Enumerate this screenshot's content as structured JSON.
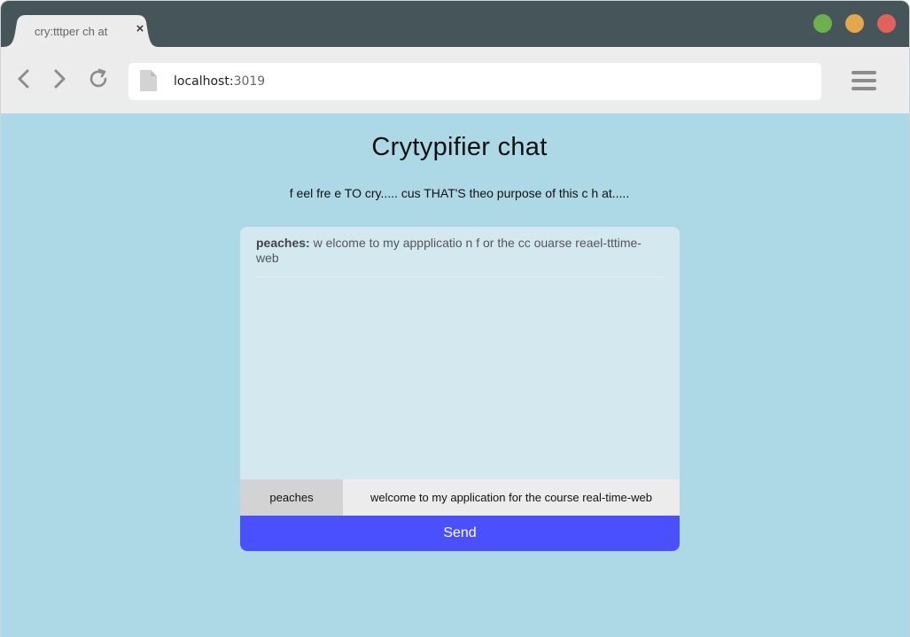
{
  "browser": {
    "tab": {
      "title": "cry:tttper ch at",
      "close_glyph": "×"
    },
    "window_controls": {
      "colors": {
        "green": "#6db14a",
        "yellow": "#e2a84b",
        "red": "#e0625a"
      }
    },
    "url": {
      "host": "localhost:",
      "port": "3019"
    },
    "icons": [
      "back-arrow-icon",
      "forward-arrow-icon",
      "reload-icon",
      "page-icon",
      "hamburger-menu-icon"
    ]
  },
  "page": {
    "title": "Crytypifier chat",
    "subtitle": "f eel fre e TO cry..... cus THAT'S theo purpose of this c h at.....",
    "background": "#add8e6"
  },
  "chat": {
    "messages": [
      {
        "user": "peaches:",
        "text": " w elcome to my appplicatio n f or the cc ouarse reael-tttime-web"
      }
    ],
    "name_input_value": "peaches",
    "message_input_value": "welcome to my application for the course real-time-web",
    "send_label": "Send",
    "accent": "#4b50ff"
  }
}
